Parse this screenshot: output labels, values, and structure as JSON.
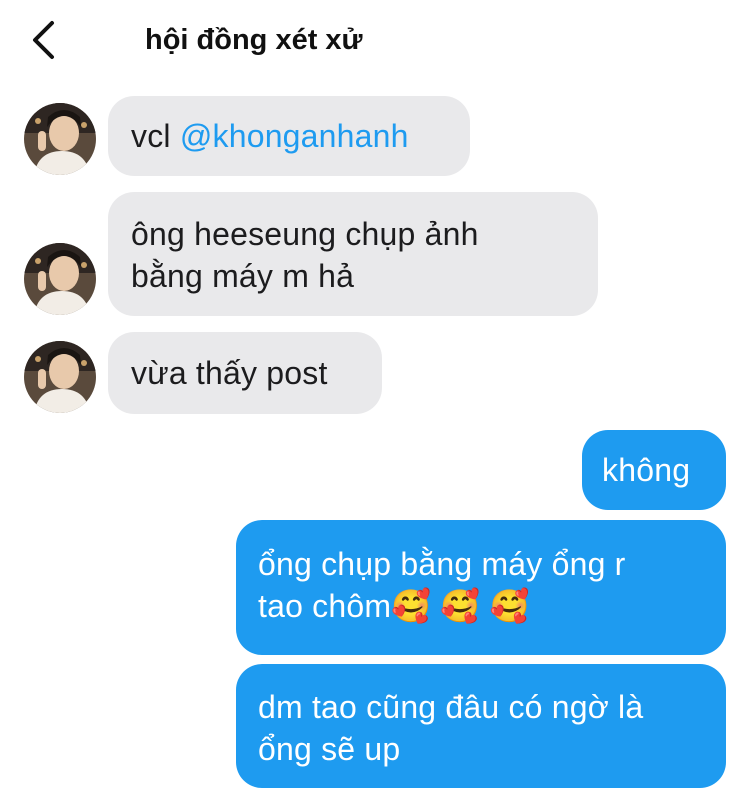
{
  "header": {
    "title": "hội đồng xét xử"
  },
  "messages": {
    "m1": {
      "text": "vcl ",
      "mention": "@khonganhanh"
    },
    "m2": {
      "line1": "ông heeseung chụp ảnh",
      "line2": "bằng máy m hả"
    },
    "m3": {
      "text": "vừa thấy post"
    },
    "m4": {
      "text": "không"
    },
    "m5": {
      "line1": "ổng chụp bằng máy ổng r",
      "line2": "tao chôm🥰 🥰 🥰"
    },
    "m6": {
      "line1": "dm tao cũng đâu có ngờ là",
      "line2": "ổng sẽ up"
    }
  },
  "colors": {
    "incoming_bubble": "#e9e9eb",
    "outgoing_bubble": "#1e9bf0",
    "mention": "#1e9bf0"
  }
}
